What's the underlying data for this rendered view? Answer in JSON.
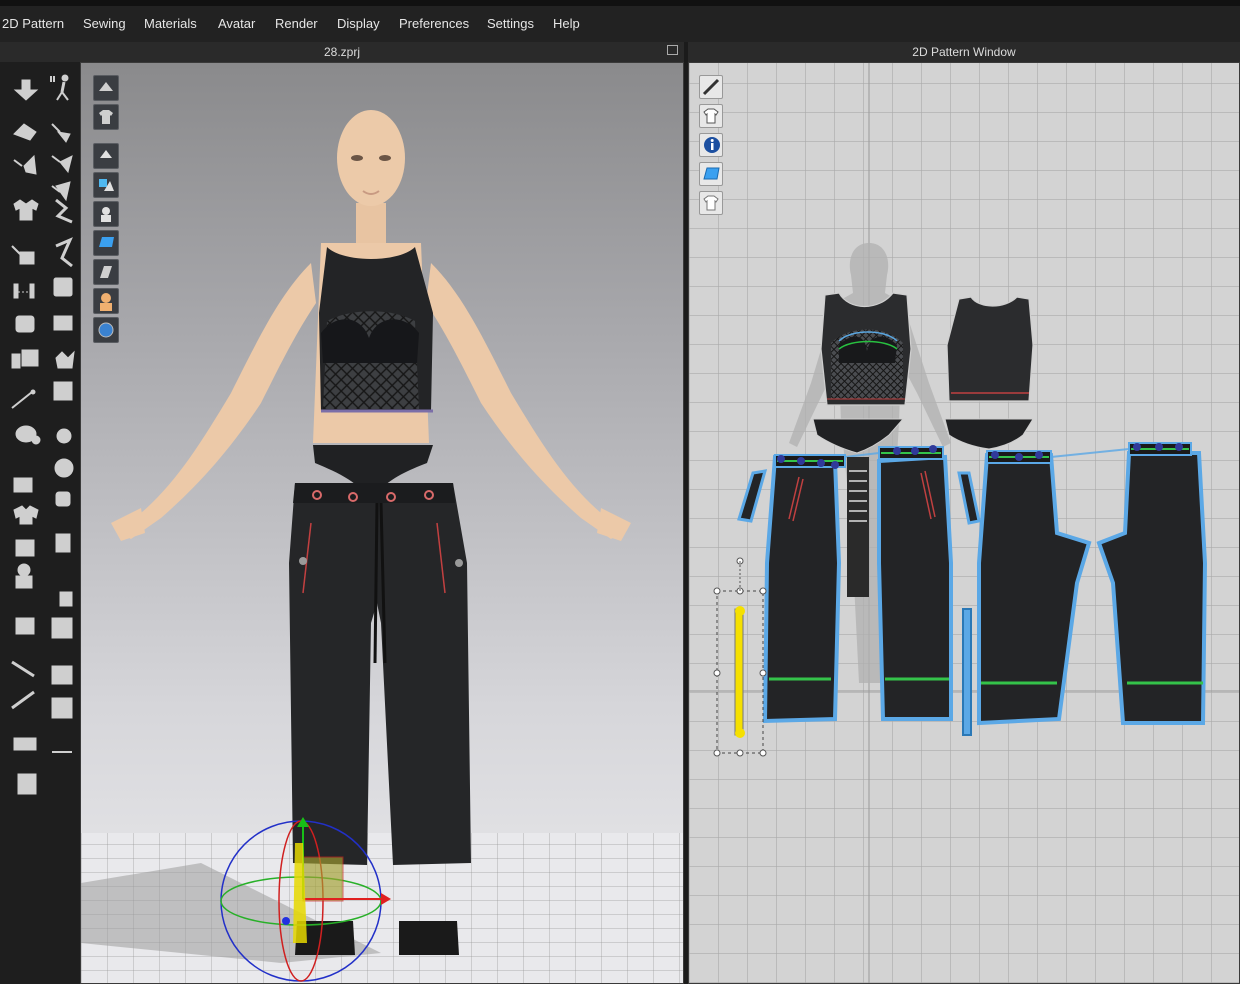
{
  "menu": [
    "2D Pattern",
    "Sewing",
    "Materials",
    "Avatar",
    "Render",
    "Display",
    "Preferences",
    "Settings",
    "Help"
  ],
  "panels": {
    "left_title": "28.zprj",
    "right_title": "2D Pattern Window"
  },
  "toolbar_icons": [
    "move-down-icon",
    "walk-icon",
    "hand-icon",
    "select-mesh-icon",
    "point-icon",
    "pin-icon",
    "pin-remove-icon",
    "shirt-fold-icon",
    "shirt-transform-icon",
    "tuck-icon",
    "fold-icon",
    "measure-icon",
    "arrange-icon",
    "pattern-icon",
    "steam-icon",
    "brush-icon",
    "button-icon",
    "buttonhole-icon",
    "lock-icon",
    "topstitch-icon",
    "gift-icon",
    "zipper-icon",
    "avatar-icon",
    "fit-icon",
    "texture-icon",
    "puckering-icon",
    "ruler-icon",
    "grain-icon",
    "tape-icon",
    "seam-icon",
    "shrink-icon"
  ],
  "viewport_icons": [
    "garment-view-icon",
    "shirt-view-icon",
    "show-garment-icon",
    "show-pattern-icon",
    "show-avatar-icon",
    "texture-surface-icon",
    "mesh-shaded-icon",
    "skin-avatar-icon",
    "globe-icon"
  ],
  "pattern_icons": [
    "pen-visibility-icon",
    "shirt-visibility-icon",
    "info-icon",
    "texture-2d-icon",
    "shirt-lock-icon"
  ],
  "colors": {
    "accent_blue": "#5ba8e6",
    "sewing_green": "#34c34a",
    "selection_yellow": "#f5e000",
    "fabric_black": "#222426",
    "skin": "#ecc9a8"
  }
}
